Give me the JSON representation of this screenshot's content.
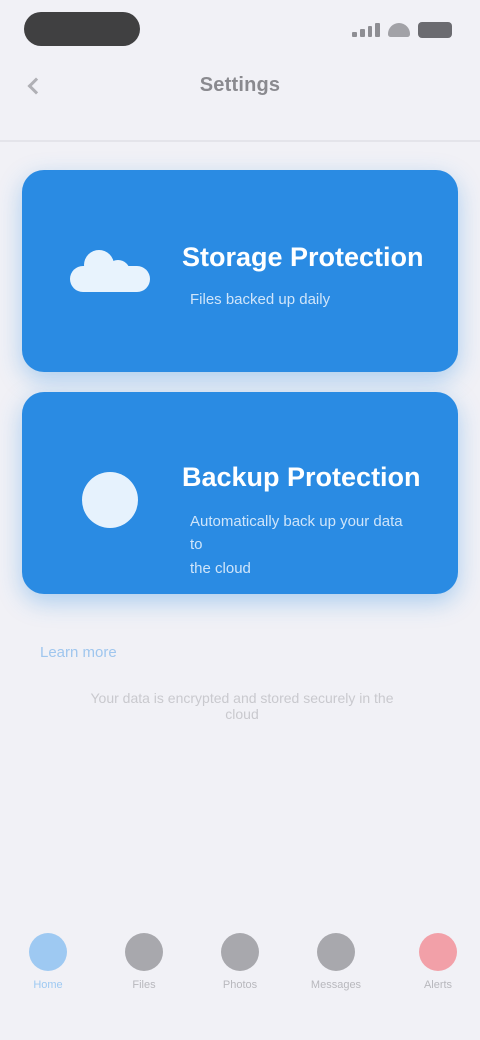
{
  "nav": {
    "title": "Settings"
  },
  "cards": [
    {
      "title": "Storage Protection",
      "subtitle": "Files backed up daily",
      "icon": "cloud-icon"
    },
    {
      "title": "Backup Protection",
      "subtitle": "Automatically back up your data to",
      "subtitle2": "the cloud",
      "icon": "circle-icon"
    }
  ],
  "section": {
    "link": "Learn more",
    "note": "Your data is encrypted and stored securely in the cloud"
  },
  "tabs": [
    {
      "label": "Home",
      "icon": "home-icon",
      "state": "active"
    },
    {
      "label": "Files",
      "icon": "files-icon",
      "state": "normal"
    },
    {
      "label": "Photos",
      "icon": "photos-icon",
      "state": "normal"
    },
    {
      "label": "Messages",
      "icon": "messages-icon",
      "state": "normal"
    },
    {
      "label": "Alerts",
      "icon": "alerts-icon",
      "state": "alert"
    }
  ],
  "colors": {
    "accent": "#2a8be3",
    "background": "#f1f1f6",
    "alert": "#f2a0a8"
  }
}
